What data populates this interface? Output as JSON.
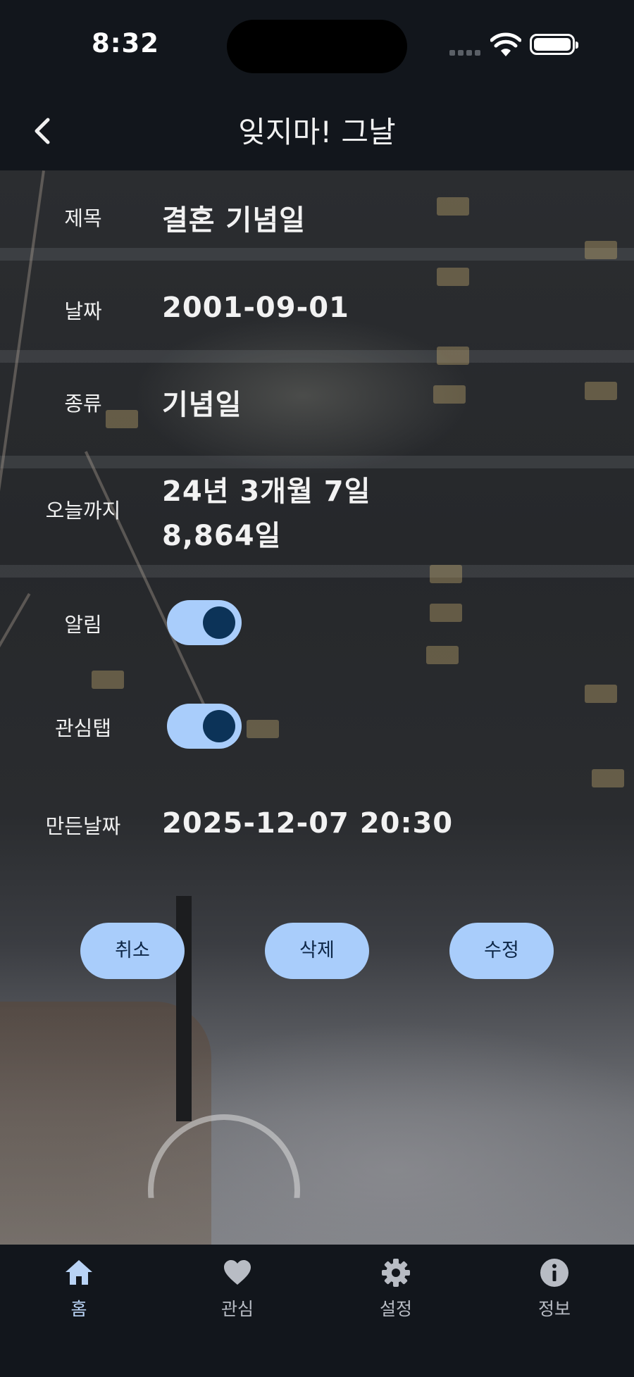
{
  "status_bar": {
    "time": "8:32"
  },
  "app_bar": {
    "title": "잊지마! 그날"
  },
  "form": {
    "title_label": "제목",
    "title_value": "결혼 기념일",
    "date_label": "날짜",
    "date_value": "2001-09-01",
    "type_label": "종류",
    "type_value": "기념일",
    "until_today_label": "오늘까지",
    "until_today_line1": "24년 3개월 7일",
    "until_today_line2": "8,864일",
    "alarm_label": "알림",
    "alarm_on": true,
    "favorite_label": "관심탭",
    "favorite_on": true,
    "created_label": "만든날짜",
    "created_value": "2025-12-07 20:30"
  },
  "actions": {
    "cancel": "취소",
    "delete": "삭제",
    "edit": "수정"
  },
  "bottom_nav": {
    "items": [
      {
        "label": "홈",
        "icon": "home-icon",
        "active": true
      },
      {
        "label": "관심",
        "icon": "heart-icon",
        "active": false
      },
      {
        "label": "설정",
        "icon": "gear-icon",
        "active": false
      },
      {
        "label": "정보",
        "icon": "info-icon",
        "active": false
      }
    ]
  },
  "colors": {
    "accent": "#a9cdfb",
    "knob": "#0c3358",
    "nav_active": "#b9d3f5",
    "nav_inactive": "#b8bcc4",
    "bar_bg": "#12161c"
  }
}
